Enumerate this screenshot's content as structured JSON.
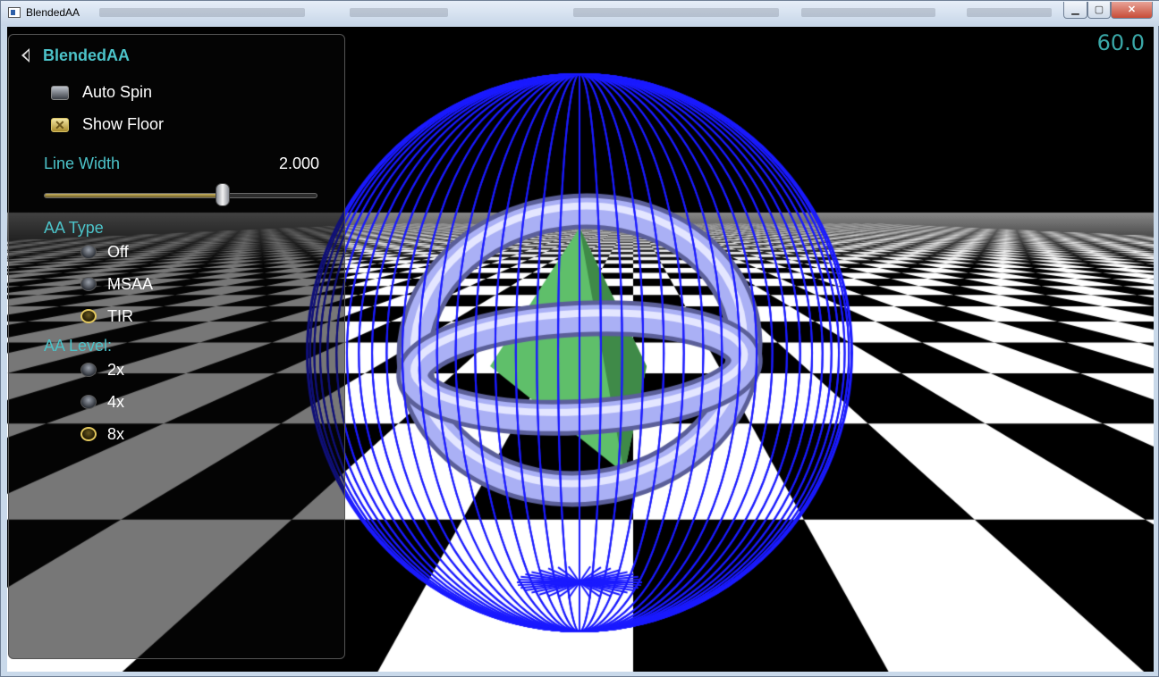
{
  "window": {
    "title": "BlendedAA",
    "controls": {
      "minimize": "▁",
      "maximize": "▢",
      "close": "✕"
    }
  },
  "hud": {
    "fps": "60.0"
  },
  "panel": {
    "title": "BlendedAA",
    "auto_spin": {
      "label": "Auto Spin",
      "checked": false
    },
    "show_floor": {
      "label": "Show Floor",
      "checked": true
    },
    "line_width": {
      "label": "Line Width",
      "value": "2.000",
      "fraction": 0.655
    },
    "aa_type": {
      "label": "AA Type",
      "options": [
        "Off",
        "MSAA",
        "TIR"
      ],
      "selected": "TIR"
    },
    "aa_level": {
      "label": "AA Level:",
      "options": [
        "2x",
        "4x",
        "8x"
      ],
      "selected": "8x"
    }
  },
  "colors": {
    "accent": "#4cc3c9",
    "wireframe": "#1a1aff",
    "torus": "#b4b9ff",
    "pyramid": "#5fbf6a",
    "selected": "#e2c75d"
  }
}
